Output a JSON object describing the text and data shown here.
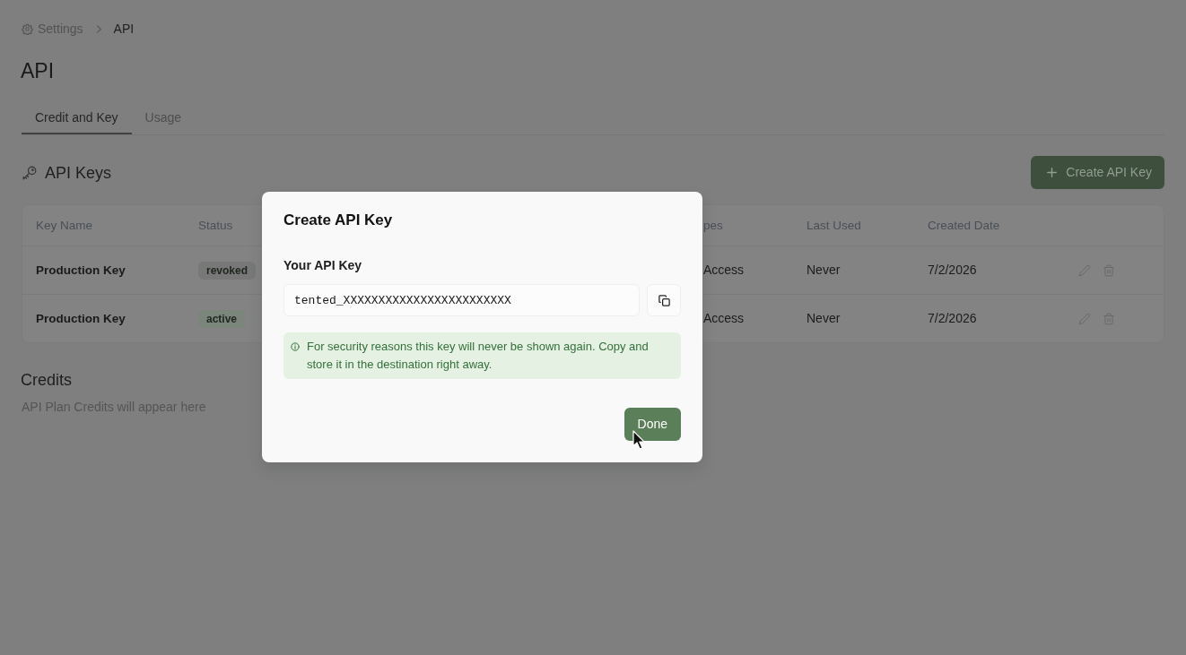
{
  "breadcrumb": {
    "items": [
      "Settings",
      "API"
    ]
  },
  "page_title": "API",
  "tabs": [
    {
      "label": "Credit and Key",
      "selected": true
    },
    {
      "label": "Usage",
      "selected": false
    }
  ],
  "api_keys": {
    "title": "API Keys",
    "create_button": "Create API Key",
    "columns": [
      "Key Name",
      "Status",
      "pes",
      "Last Used",
      "Created Date"
    ],
    "rows": [
      {
        "key_name": "Production Key",
        "status": {
          "label": "revoked",
          "color": "#787878"
        },
        "column_3": "Access",
        "last_used": "Never",
        "created_date": "7/2/2026"
      },
      {
        "key_name": "Production Key",
        "status": {
          "label": "active",
          "color": "#7a8679"
        },
        "column_3": "Access",
        "last_used": "Never",
        "created_date": "7/2/2026"
      }
    ]
  },
  "credits": {
    "title": "Credits",
    "text": "API Plan Credits will appear here"
  },
  "dialog": {
    "title": "Create API Key",
    "field_label": "Your API Key",
    "api_key": "tented_XXXXXXXXXXXXXXXXXXXXXXXX",
    "notice": "For security reasons this key will never be shown again. Copy and store it in the destination right away.",
    "done_button": "Done"
  }
}
